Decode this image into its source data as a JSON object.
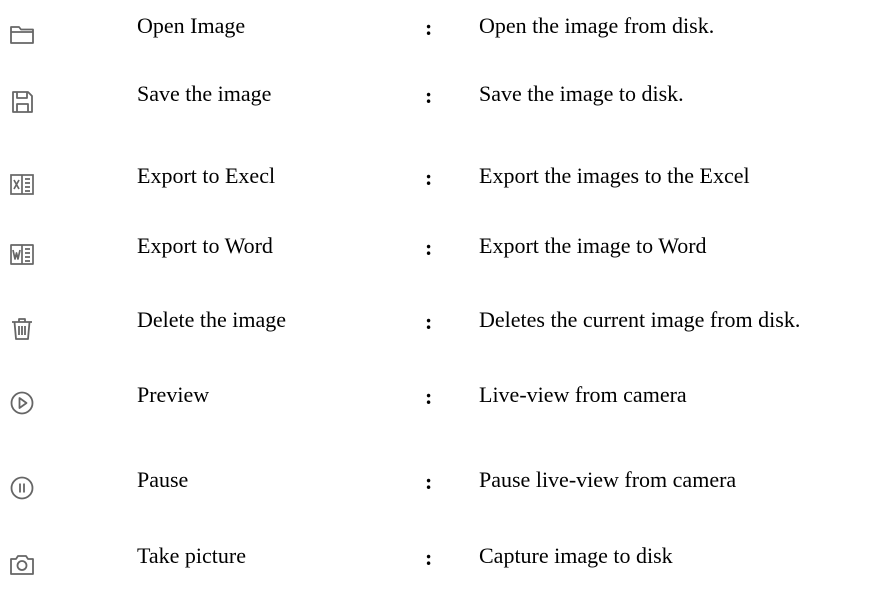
{
  "icon_color": "#666666",
  "rows": [
    {
      "icon": "folder-open-icon",
      "label": "Open Image",
      "colon": ":",
      "description": "Open the image from disk."
    },
    {
      "icon": "save-icon",
      "label": "Save the image",
      "colon": ":",
      "description": "Save the image to disk."
    },
    {
      "icon": "excel-export-icon",
      "label": "Export to Execl",
      "colon": ":",
      "description": "Export the images to the Excel"
    },
    {
      "icon": "word-export-icon",
      "label": "Export to Word",
      "colon": ":",
      "description": "Export the image to Word"
    },
    {
      "icon": "trash-icon",
      "label": "Delete the image",
      "colon": ":",
      "description": "Deletes the current image from disk."
    },
    {
      "icon": "play-icon",
      "label": "Preview",
      "colon": ":",
      "description": "Live-view from camera"
    },
    {
      "icon": "pause-icon",
      "label": "Pause",
      "colon": ":",
      "description": "Pause live-view from camera"
    },
    {
      "icon": "camera-icon",
      "label": "Take picture",
      "colon": ":",
      "description": "Capture image to disk"
    }
  ]
}
